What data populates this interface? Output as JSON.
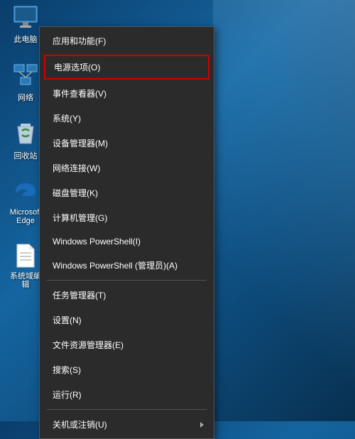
{
  "desktop": {
    "icons": [
      {
        "name": "this-pc",
        "label": "此电脑"
      },
      {
        "name": "network",
        "label": "网络"
      },
      {
        "name": "recycle-bin",
        "label": "回收站"
      },
      {
        "name": "edge",
        "label": "Microsoft Edge"
      },
      {
        "name": "file",
        "label": "系统域编辑"
      }
    ]
  },
  "menu": {
    "groups": [
      [
        {
          "label": "应用和功能(F)",
          "highlighted": false,
          "submenu": false
        },
        {
          "label": "电源选项(O)",
          "highlighted": true,
          "submenu": false
        },
        {
          "label": "事件查看器(V)",
          "highlighted": false,
          "submenu": false
        },
        {
          "label": "系统(Y)",
          "highlighted": false,
          "submenu": false
        },
        {
          "label": "设备管理器(M)",
          "highlighted": false,
          "submenu": false
        },
        {
          "label": "网络连接(W)",
          "highlighted": false,
          "submenu": false
        },
        {
          "label": "磁盘管理(K)",
          "highlighted": false,
          "submenu": false
        },
        {
          "label": "计算机管理(G)",
          "highlighted": false,
          "submenu": false
        },
        {
          "label": "Windows PowerShell(I)",
          "highlighted": false,
          "submenu": false
        },
        {
          "label": "Windows PowerShell (管理员)(A)",
          "highlighted": false,
          "submenu": false
        }
      ],
      [
        {
          "label": "任务管理器(T)",
          "highlighted": false,
          "submenu": false
        },
        {
          "label": "设置(N)",
          "highlighted": false,
          "submenu": false
        },
        {
          "label": "文件资源管理器(E)",
          "highlighted": false,
          "submenu": false
        },
        {
          "label": "搜索(S)",
          "highlighted": false,
          "submenu": false
        },
        {
          "label": "运行(R)",
          "highlighted": false,
          "submenu": false
        }
      ],
      [
        {
          "label": "关机或注销(U)",
          "highlighted": false,
          "submenu": true
        }
      ]
    ]
  }
}
